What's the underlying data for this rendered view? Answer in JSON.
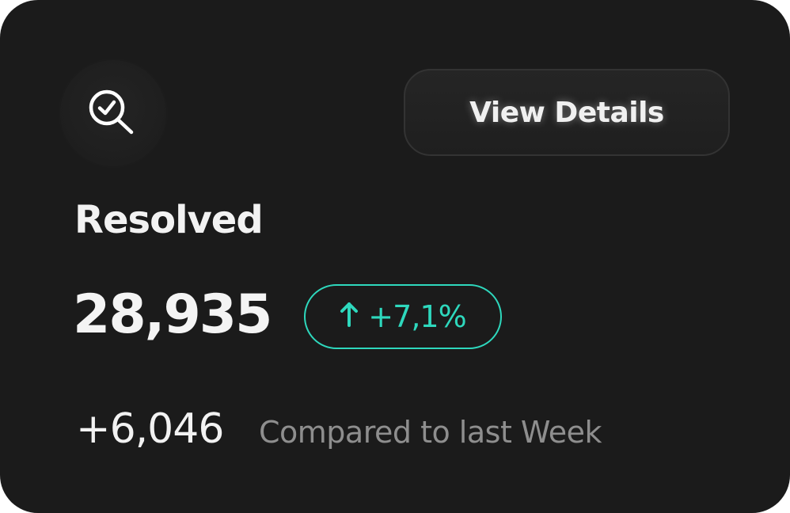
{
  "card": {
    "icon": "search-check-icon",
    "view_button_label": "View Details",
    "title": "Resolved",
    "value": "28,935",
    "change": {
      "arrow_icon": "arrow-up-icon",
      "text": "+7,1%",
      "color": "#2ed8bd"
    },
    "delta": "+6,046",
    "compare_text": "Compared to last Week"
  },
  "colors": {
    "background": "#1b1b1b",
    "text": "#f2f2f2",
    "muted_text": "#8e8e8e",
    "accent": "#2ed8bd"
  }
}
